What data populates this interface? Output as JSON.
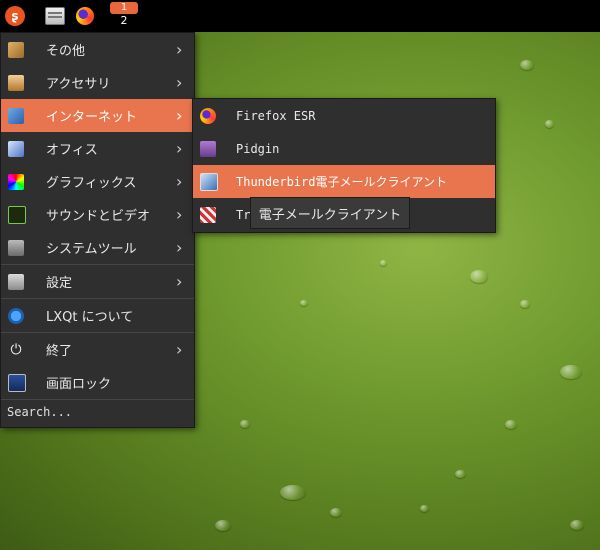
{
  "panel": {
    "workspace_badge": "1",
    "workspace_number": "2",
    "start_icon": "distro-logo-icon",
    "file_manager_icon": "file-manager-icon",
    "browser_icon": "firefox-icon"
  },
  "menu": {
    "items": [
      {
        "label": "その他",
        "icon": "other-apps-icon"
      },
      {
        "label": "アクセサリ",
        "icon": "accessories-icon"
      },
      {
        "label": "インターネット",
        "icon": "internet-icon"
      },
      {
        "label": "オフィス",
        "icon": "office-icon"
      },
      {
        "label": "グラフィックス",
        "icon": "graphics-icon"
      },
      {
        "label": "サウンドとビデオ",
        "icon": "multimedia-icon"
      },
      {
        "label": "システムツール",
        "icon": "system-tools-icon"
      },
      {
        "label": "設定",
        "icon": "settings-icon"
      },
      {
        "label": "LXQt について",
        "icon": "lxqt-icon"
      },
      {
        "label": "終了",
        "icon": "power-icon"
      },
      {
        "label": "画面ロック",
        "icon": "lock-screen-icon"
      }
    ],
    "search_label": "Search..."
  },
  "submenu": {
    "items": [
      {
        "label": "Firefox ESR",
        "icon": "firefox-icon"
      },
      {
        "label": "Pidgin",
        "icon": "pidgin-icon"
      },
      {
        "label": "Thunderbird電子メールクライアント",
        "icon": "thunderbird-icon"
      },
      {
        "label": "Tr",
        "icon": "transmission-icon"
      }
    ]
  },
  "tooltip": {
    "text": "電子メールクライアント"
  },
  "colors": {
    "accent": "#e8754d",
    "menu_bg": "#2f2f2f",
    "panel_bg": "#000000"
  }
}
